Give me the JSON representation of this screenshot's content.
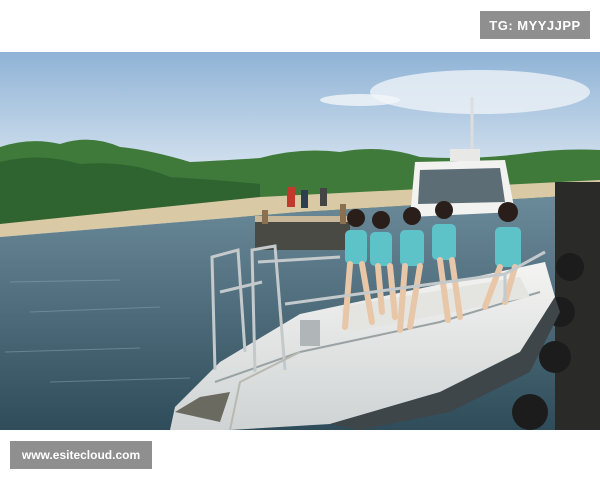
{
  "watermark_top": "TG: MYYJJPP",
  "watermark_bottom": "www.esitecloud.com"
}
